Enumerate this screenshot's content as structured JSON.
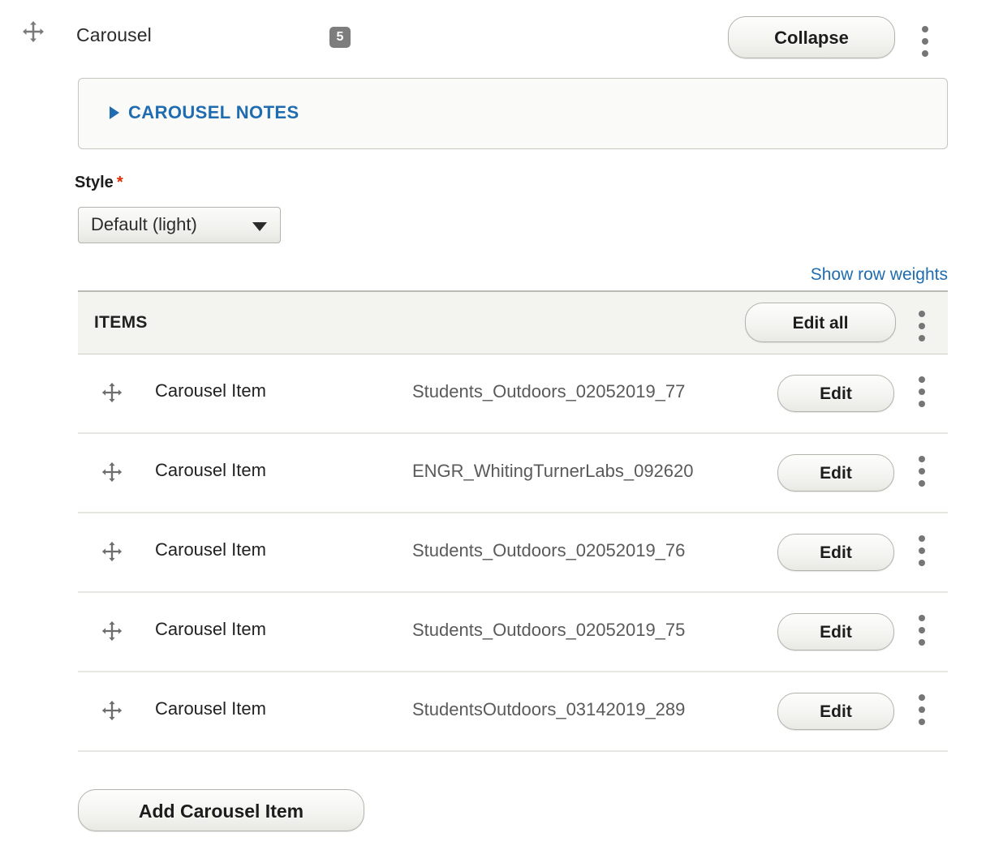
{
  "header": {
    "drag_icon": "move-handle-icon",
    "title": "Carousel",
    "count": "5",
    "collapse_label": "Collapse",
    "menu_icon": "vertical-ellipsis-icon"
  },
  "notes": {
    "toggle_icon": "triangle-right-icon",
    "label": "CAROUSEL NOTES"
  },
  "style_field": {
    "label": "Style",
    "required_mark": "*",
    "selected_value": "Default (light)",
    "dropdown_icon": "chevron-down-icon"
  },
  "table": {
    "show_row_weights_label": "Show row weights",
    "header_label": "ITEMS",
    "edit_all_label": "Edit all",
    "menu_icon": "vertical-ellipsis-icon",
    "row_edit_label": "Edit",
    "rows": [
      {
        "drag_icon": "move-handle-icon",
        "type": "Carousel Item",
        "filename": "Students_Outdoors_02052019_77",
        "edit_label": "Edit"
      },
      {
        "drag_icon": "move-handle-icon",
        "type": "Carousel Item",
        "filename": "ENGR_WhitingTurnerLabs_092620",
        "edit_label": "Edit"
      },
      {
        "drag_icon": "move-handle-icon",
        "type": "Carousel Item",
        "filename": "Students_Outdoors_02052019_76",
        "edit_label": "Edit"
      },
      {
        "drag_icon": "move-handle-icon",
        "type": "Carousel Item",
        "filename": "Students_Outdoors_02052019_75",
        "edit_label": "Edit"
      },
      {
        "drag_icon": "move-handle-icon",
        "type": "Carousel Item",
        "filename": "StudentsOutdoors_03142019_289",
        "edit_label": "Edit"
      }
    ]
  },
  "footer": {
    "add_item_label": "Add Carousel Item"
  },
  "colors": {
    "link_blue": "#1f6cb0",
    "required_red": "#e32a00",
    "badge_gray": "#7d7d7d",
    "table_header_bg": "#f3f4ef"
  }
}
